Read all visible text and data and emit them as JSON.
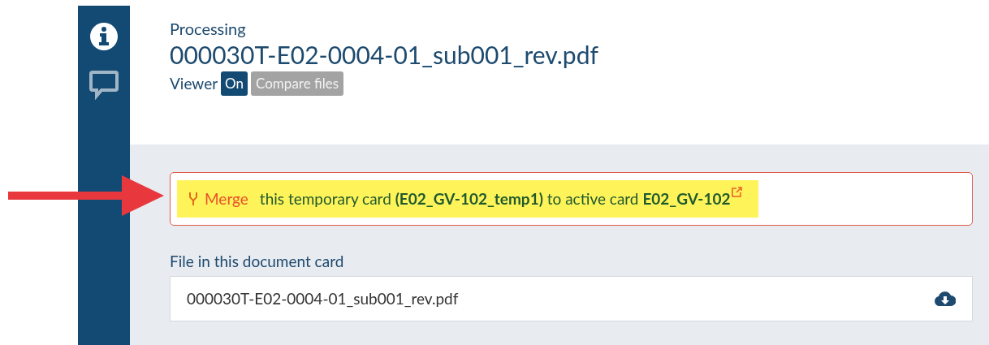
{
  "sidebar": {
    "items": [
      {
        "kind": "info",
        "selected": true
      },
      {
        "kind": "comments",
        "selected": false
      }
    ]
  },
  "header": {
    "status": "Processing",
    "title": "000030T-E02-0004-01_sub001_rev.pdf",
    "viewer_label": "Viewer",
    "viewer_buttons": [
      {
        "label": "On",
        "selected": true
      },
      {
        "label": "Compare files",
        "selected": false
      }
    ]
  },
  "merge_alert": {
    "action": "Merge",
    "message": "this temporary card **(E02_GV-102_temp1)** to active card **E02_GV-102**",
    "highlighted": true
  },
  "file_section": {
    "label": "File in this document card",
    "file_name": "000030T-E02-0004-01_sub001_rev.pdf"
  }
}
